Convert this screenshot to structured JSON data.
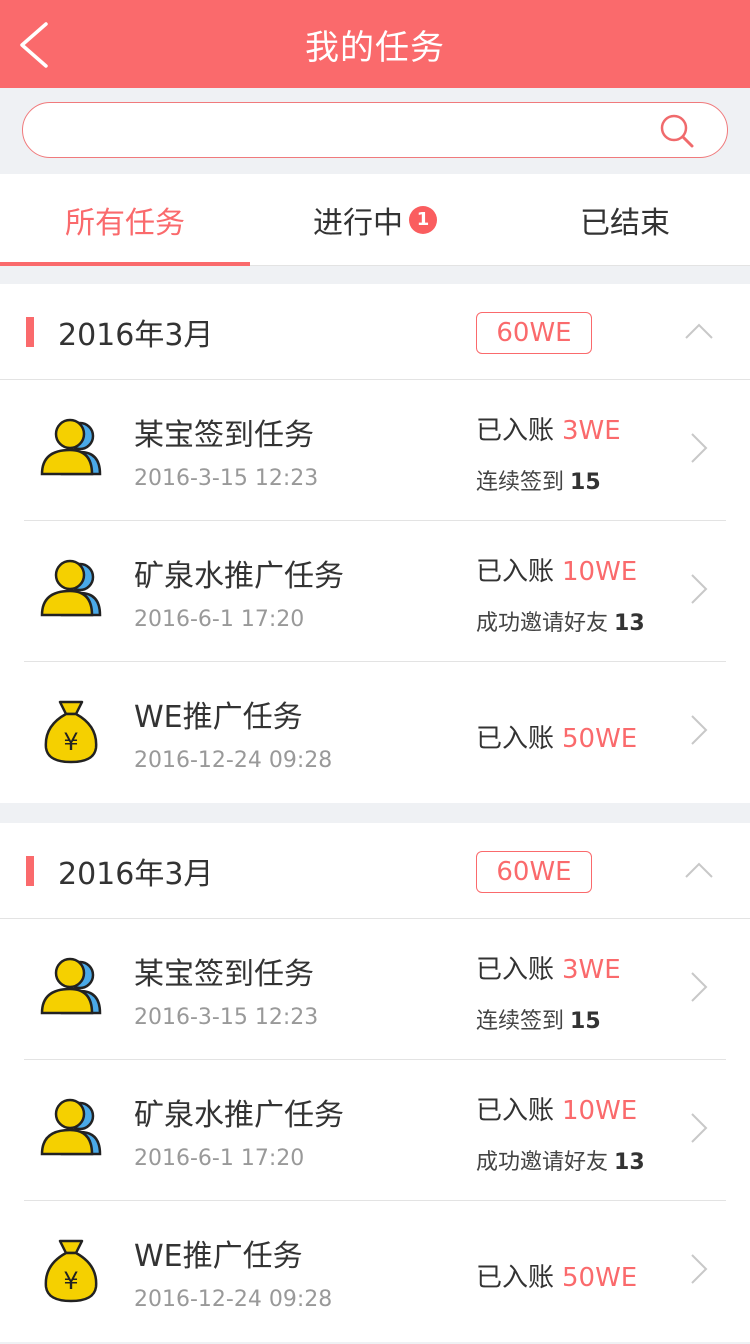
{
  "header": {
    "title": "我的任务"
  },
  "search": {
    "placeholder": ""
  },
  "tabs": [
    {
      "label": "所有任务",
      "active": true
    },
    {
      "label": "进行中",
      "badge": "1"
    },
    {
      "label": "已结束"
    }
  ],
  "colors": {
    "accent": "#fa6a6c",
    "person_yellow": "#f5d000",
    "person_blue": "#4aa9e8"
  },
  "groups": [
    {
      "month": "2016年3月",
      "total": "60WE",
      "tasks": [
        {
          "icon": "users-icon",
          "name": "某宝签到任务",
          "time": "2016-3-15 12:23",
          "credit_label": "已入账",
          "amount": "3WE",
          "extra_label": "连续签到",
          "extra_value": "15"
        },
        {
          "icon": "users-icon",
          "name": "矿泉水推广任务",
          "time": "2016-6-1 17:20",
          "credit_label": "已入账",
          "amount": "10WE",
          "extra_label": "成功邀请好友",
          "extra_value": "13"
        },
        {
          "icon": "money-bag-icon",
          "name": "WE推广任务",
          "time": "2016-12-24 09:28",
          "credit_label": "已入账",
          "amount": "50WE"
        }
      ]
    },
    {
      "month": "2016年3月",
      "total": "60WE",
      "tasks": [
        {
          "icon": "users-icon",
          "name": "某宝签到任务",
          "time": "2016-3-15 12:23",
          "credit_label": "已入账",
          "amount": "3WE",
          "extra_label": "连续签到",
          "extra_value": "15"
        },
        {
          "icon": "users-icon",
          "name": "矿泉水推广任务",
          "time": "2016-6-1 17:20",
          "credit_label": "已入账",
          "amount": "10WE",
          "extra_label": "成功邀请好友",
          "extra_value": "13"
        },
        {
          "icon": "money-bag-icon",
          "name": "WE推广任务",
          "time": "2016-12-24 09:28",
          "credit_label": "已入账",
          "amount": "50WE"
        }
      ]
    }
  ]
}
